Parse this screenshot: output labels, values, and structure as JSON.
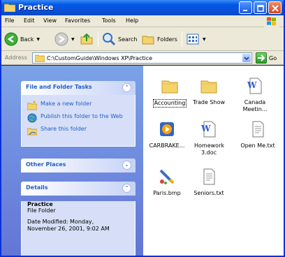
{
  "window": {
    "title": "Practice"
  },
  "menu": {
    "items": [
      "File",
      "Edit",
      "View",
      "Favorites",
      "Tools",
      "Help"
    ]
  },
  "toolbar": {
    "back_label": "Back",
    "search_label": "Search",
    "folders_label": "Folders"
  },
  "address": {
    "label": "Address",
    "value": "C:\\CustomGuide\\Windows XP\\Practice",
    "go_label": "Go"
  },
  "taskpane": {
    "file_tasks": {
      "title": "File and Folder Tasks",
      "items": [
        {
          "label": "Make a new folder",
          "icon": "new-folder-icon"
        },
        {
          "label": "Publish this folder to the Web",
          "icon": "publish-web-icon"
        },
        {
          "label": "Share this folder",
          "icon": "share-folder-icon"
        }
      ]
    },
    "other_places": {
      "title": "Other Places"
    },
    "details": {
      "title": "Details",
      "name": "Practice",
      "type": "File Folder",
      "date_line1": "Date Modified: Monday,",
      "date_line2": "November 26, 2001, 9:02 AM"
    }
  },
  "files": [
    {
      "name": "Accounting",
      "icon": "folder-icon",
      "selected": true
    },
    {
      "name": "Trade Show",
      "icon": "folder-icon",
      "selected": false
    },
    {
      "name": "Canada Meetin...",
      "icon": "word-doc-icon",
      "selected": false
    },
    {
      "name": "CARBRAKE...",
      "icon": "media-file-icon",
      "selected": false
    },
    {
      "name": "Homework 3.doc",
      "icon": "word-doc-icon",
      "selected": false
    },
    {
      "name": "Open Me.txt",
      "icon": "text-file-icon",
      "selected": false
    },
    {
      "name": "Paris.bmp",
      "icon": "paint-file-icon",
      "selected": false
    },
    {
      "name": "Seniors.txt",
      "icon": "text-file-icon",
      "selected": false
    }
  ],
  "colors": {
    "titlebar": "#0058e6",
    "taskpane_top": "#7ba2e7",
    "taskpane_bottom": "#6375d6",
    "link_blue": "#215dc6",
    "folder_yellow": "#f5d36b"
  }
}
